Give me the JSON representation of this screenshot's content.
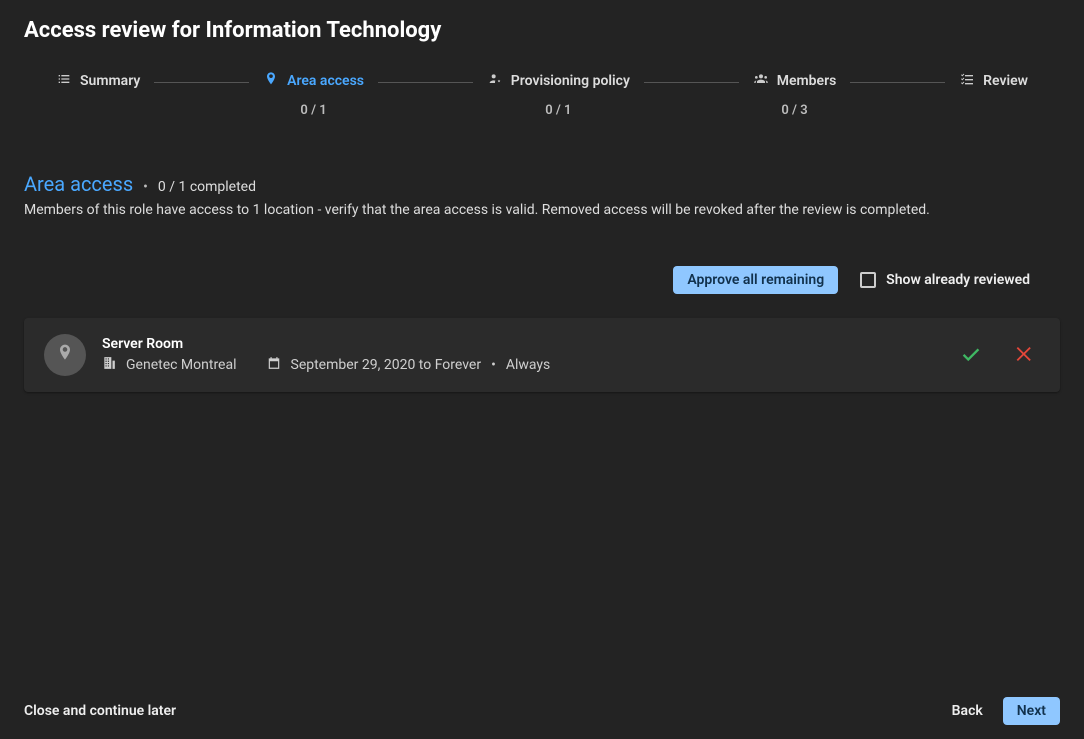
{
  "header": {
    "title": "Access review for Information Technology"
  },
  "stepper": {
    "summary": {
      "label": "Summary"
    },
    "area_access": {
      "label": "Area access",
      "sub": "0 / 1"
    },
    "provisioning": {
      "label": "Provisioning policy",
      "sub": "0 / 1"
    },
    "members": {
      "label": "Members",
      "sub": "0 / 3"
    },
    "review": {
      "label": "Review"
    }
  },
  "section": {
    "title": "Area access",
    "counter": "0 / 1 completed",
    "description": "Members of this role have access to 1 location - verify that the area access is valid. Removed access will be revoked after the review is completed."
  },
  "controls": {
    "approve_all": "Approve all remaining",
    "show_reviewed": "Show already reviewed"
  },
  "item": {
    "name": "Server Room",
    "location": "Genetec Montreal",
    "timeframe": "September 29, 2020 to Forever",
    "schedule": "Always"
  },
  "footer": {
    "close": "Close and continue later",
    "back": "Back",
    "next": "Next"
  }
}
